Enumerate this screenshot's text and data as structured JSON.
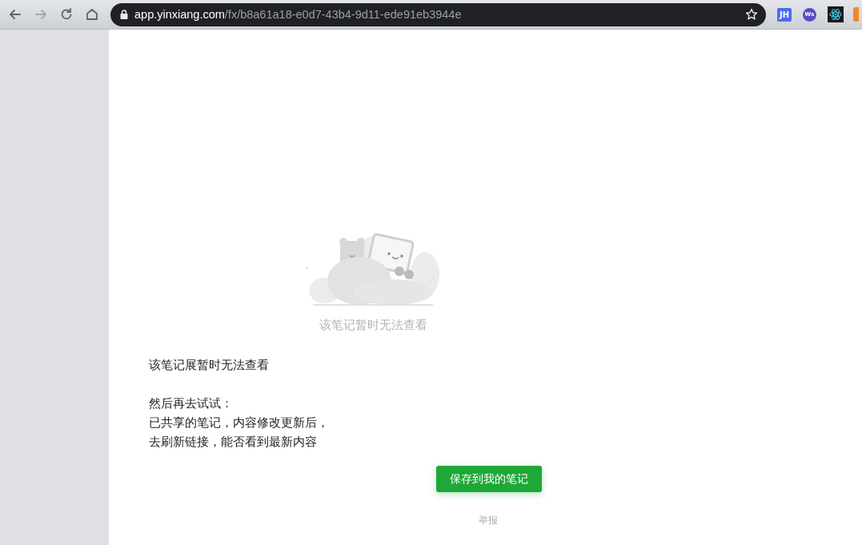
{
  "browser": {
    "url_host": "app.yinxiang.com",
    "url_path": "/fx/b8a61a18-e0d7-43b4-9d11-ede91eb3944e",
    "bookmarked": false,
    "extensions": [
      {
        "kind": "badge",
        "label": "JH",
        "color": "#4a6cf0"
      },
      {
        "kind": "round",
        "label": "Ws",
        "color": "#5b4bc4"
      },
      {
        "kind": "atom",
        "color": "#1a1a1a"
      },
      {
        "kind": "partial",
        "color": "#f08a24"
      }
    ]
  },
  "empty_state": {
    "caption": "该笔记暂时无法查看"
  },
  "message": {
    "title": "该笔记展暂时无法查看",
    "lines": [
      "然后再去试试：",
      "已共享的笔记，内容修改更新后，",
      "去刷新链接，能否看到最新内容"
    ]
  },
  "save_button": "保存到我的笔记",
  "report_link": "举报"
}
